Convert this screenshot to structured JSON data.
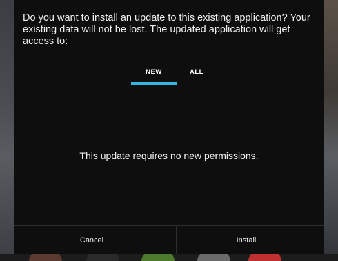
{
  "dialog": {
    "message": "Do you want to install an update to this existing application? Your existing data will not be lost. The updated application will get access to:",
    "tabs": [
      {
        "label": "NEW",
        "selected": true
      },
      {
        "label": "ALL",
        "selected": false
      }
    ],
    "permissions_text": "This update requires no new permissions.",
    "buttons": {
      "cancel": "Cancel",
      "install": "Install"
    }
  },
  "colors": {
    "accent": "#33b5e5",
    "dialog_bg": "#0e0e0e",
    "text": "#f0f0f0"
  }
}
